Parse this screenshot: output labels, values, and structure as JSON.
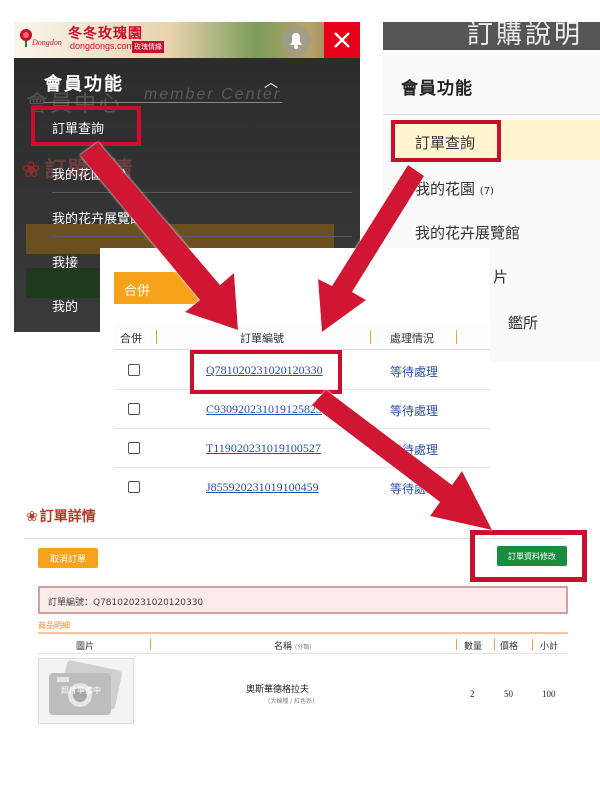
{
  "mobile_panel": {
    "logo_text": "冬冬玫瑰園",
    "logo_url": "dongdongs.com",
    "logo_badge": "玫瑰情緣",
    "logo_brand": "Dongdong",
    "menu_title": "會員功能",
    "bg_title": "會員中心",
    "bg_subtitle": "member Center",
    "bg_detail": "訂單詳情",
    "menu_items": [
      {
        "label": "訂單查詢"
      },
      {
        "label": "我的花園 (7)"
      },
      {
        "label": "我的花卉展覽館"
      },
      {
        "label": "我接"
      },
      {
        "label": "我的"
      }
    ]
  },
  "desktop_panel": {
    "top_text": "訂購說明",
    "menu_title": "會員功能",
    "items": [
      {
        "label": "訂單查詢"
      },
      {
        "label": "我的花園",
        "count": "(7)"
      },
      {
        "label": "我的花卉展覽館"
      },
      {
        "label": "片"
      },
      {
        "label": "鑑所"
      }
    ]
  },
  "order_list": {
    "merge_button": "合併",
    "columns": [
      "合併",
      "訂單編號",
      "處理情況"
    ],
    "rows": [
      {
        "order_no": "Q781020231020120330",
        "status": "等待處理"
      },
      {
        "order_no": "C930920231019125823",
        "status": "等待處理"
      },
      {
        "order_no": "T119020231019100527",
        "status": "等待處理"
      },
      {
        "order_no": "J855920231019100459",
        "status": "等待處理"
      }
    ]
  },
  "order_detail": {
    "heading": "訂單詳情",
    "cancel_button": "取消訂單",
    "edit_button": "訂單資料修改",
    "order_no_label": "訂單編號：Q781020231020120330",
    "section_title": "商品明細",
    "columns": {
      "image": "圖片",
      "name": "名稱",
      "name_note": "(分類)",
      "qty": "數量",
      "price": "價格",
      "subtotal": "小計"
    },
    "product": {
      "image_placeholder": "照片準備中",
      "name": "奧斯華德格拉夫",
      "note": "(大輪種 / 紅色系)",
      "qty": "2",
      "price": "50",
      "subtotal": "100"
    }
  },
  "colors": {
    "highlight": "#c8102e",
    "accent_orange": "#f7a21b",
    "link_blue": "#2d4fa8",
    "edit_green": "#1a8c3d"
  }
}
